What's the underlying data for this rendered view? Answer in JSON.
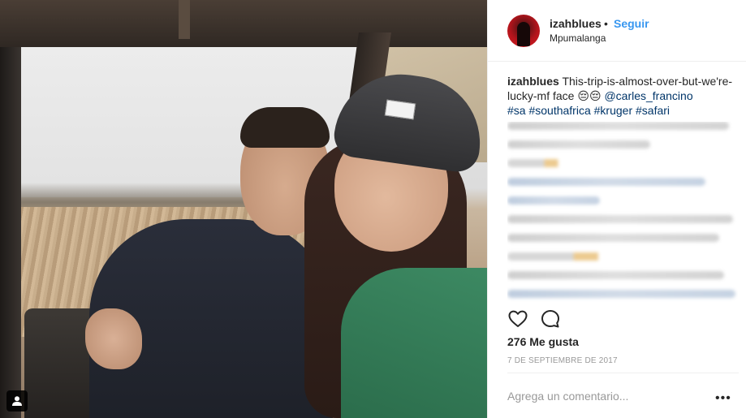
{
  "header": {
    "username": "izahblues",
    "separator": "•",
    "follow_label": "Seguir",
    "location": "Mpumalanga"
  },
  "caption": {
    "username": "izahblues",
    "text": "This-trip-is-almost-over-but-we're-lucky-mf face",
    "emoji": "😔😔",
    "mention": "@carles_francino",
    "hashtags": [
      "#sa",
      "#southafrica",
      "#kruger",
      "#safari"
    ]
  },
  "actions": {
    "like_icon": "heart-icon",
    "comment_icon": "comment-icon"
  },
  "likes_text": "276 Me gusta",
  "date": "7 DE SEPTIEMBRE DE 2017",
  "comment_box": {
    "placeholder": "Agrega un comentario...",
    "more": "•••"
  },
  "photo": {
    "tag_icon": "user-tag-icon"
  },
  "colors": {
    "accent": "#3897f0",
    "link": "#003569",
    "text": "#262626",
    "muted": "#999999"
  }
}
